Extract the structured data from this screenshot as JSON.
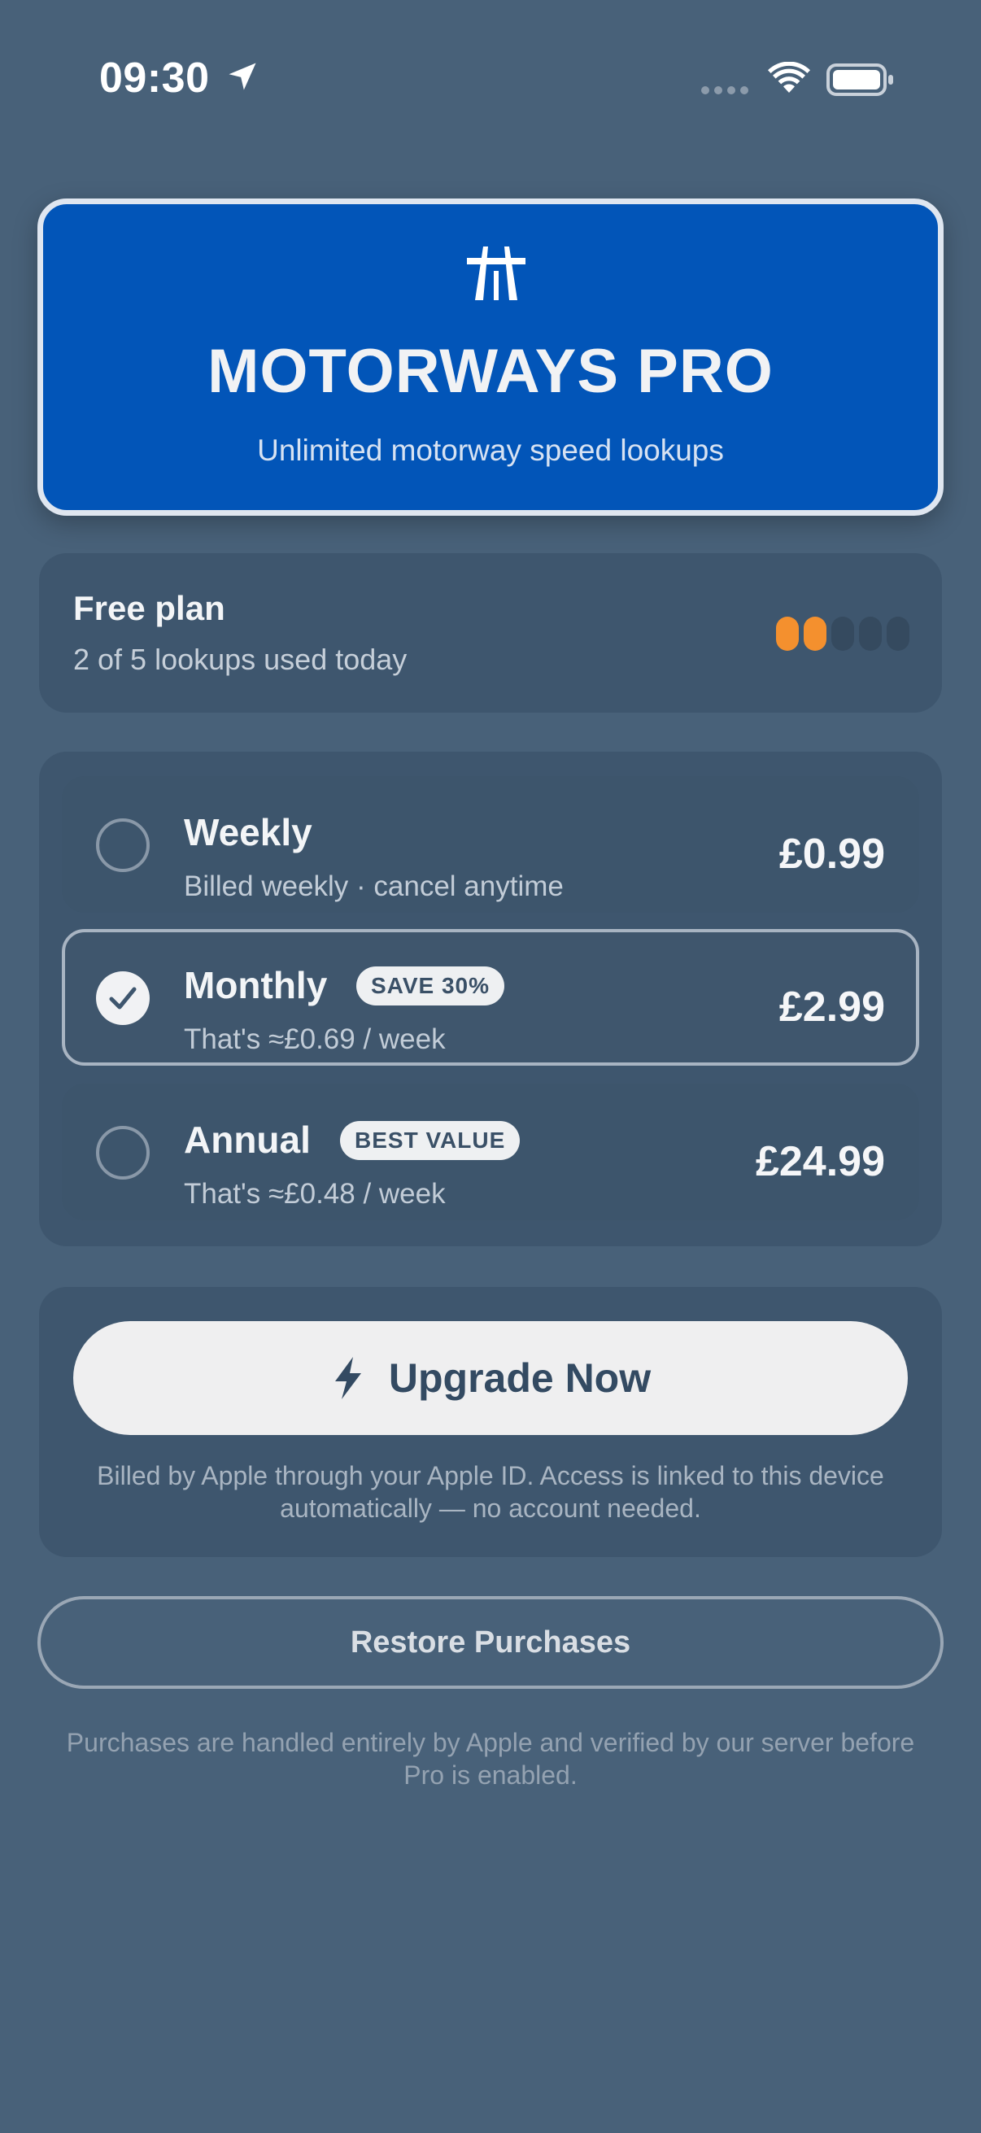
{
  "status_bar": {
    "time": "09:30",
    "icons": [
      "location-arrow-icon",
      "signal-icon",
      "wifi-icon",
      "battery-icon"
    ]
  },
  "hero": {
    "icon": "motorway-icon",
    "title": "MOTORWAYS PRO",
    "subtitle": "Unlimited motorway speed lookups",
    "background_color": "#0255b8"
  },
  "free_plan": {
    "title": "Free plan",
    "subtitle": "2 of 5 lookups used today",
    "used": 2,
    "total": 5,
    "used_color": "#f4902e"
  },
  "plans": [
    {
      "name": "Weekly",
      "badge": "",
      "description": "Billed weekly · cancel anytime",
      "price": "£0.99",
      "selected": false
    },
    {
      "name": "Monthly",
      "badge": "SAVE 30%",
      "description": "That's ≈£0.69 / week",
      "price": "£2.99",
      "selected": true
    },
    {
      "name": "Annual",
      "badge": "BEST VALUE",
      "description": "That's ≈£0.48 / week",
      "price": "£24.99",
      "selected": false
    }
  ],
  "upgrade": {
    "icon": "lightning-bolt-icon",
    "label": "Upgrade Now",
    "note": "Billed by Apple through your Apple ID. Access is linked to this device automatically — no account needed."
  },
  "restore": {
    "label": "Restore Purchases"
  },
  "footer": {
    "note": "Purchases are handled entirely by Apple and verified by our server before Pro is enabled."
  }
}
